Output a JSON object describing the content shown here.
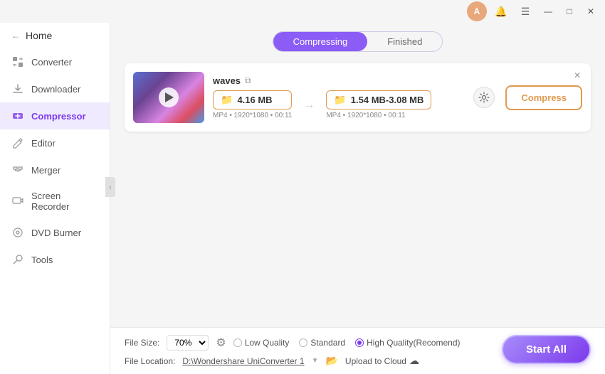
{
  "titlebar": {
    "avatar_initials": "A",
    "notification_icon": "🔔",
    "menu_icon": "☰",
    "minimize_label": "—",
    "maximize_label": "□",
    "close_label": "✕"
  },
  "sidebar": {
    "home_label": "Home",
    "items": [
      {
        "id": "converter",
        "label": "Converter",
        "active": false
      },
      {
        "id": "downloader",
        "label": "Downloader",
        "active": false
      },
      {
        "id": "compressor",
        "label": "Compressor",
        "active": true
      },
      {
        "id": "editor",
        "label": "Editor",
        "active": false
      },
      {
        "id": "merger",
        "label": "Merger",
        "active": false
      },
      {
        "id": "screen-recorder",
        "label": "Screen Recorder",
        "active": false
      },
      {
        "id": "dvd-burner",
        "label": "DVD Burner",
        "active": false
      },
      {
        "id": "tools",
        "label": "Tools",
        "active": false
      }
    ],
    "collapse_icon": "‹"
  },
  "tabs": {
    "items": [
      {
        "id": "compressing",
        "label": "Compressing",
        "active": true
      },
      {
        "id": "finished",
        "label": "Finished",
        "active": false
      }
    ]
  },
  "file_card": {
    "filename": "waves",
    "link_icon": "⧉",
    "close_icon": "✕",
    "original_size": "4.16 MB",
    "target_size": "1.54 MB-3.08 MB",
    "meta_original": "MP4  •  1920*1080  •  00:11",
    "meta_target": "MP4  •  1920*1080  •  00:11",
    "compress_btn_label": "Compress",
    "settings_icon": "⚙"
  },
  "bottom_bar": {
    "file_size_label": "File Size:",
    "size_percent": "70%",
    "quality_options": [
      {
        "id": "low",
        "label": "Low Quality",
        "checked": false
      },
      {
        "id": "standard",
        "label": "Standard",
        "checked": false
      },
      {
        "id": "high",
        "label": "High Quality(Recomend)",
        "checked": true
      }
    ],
    "file_location_label": "File Location:",
    "location_path": "D:\\Wondershare UniConverter 1",
    "upload_cloud_label": "Upload to Cloud",
    "start_all_label": "Start All"
  }
}
